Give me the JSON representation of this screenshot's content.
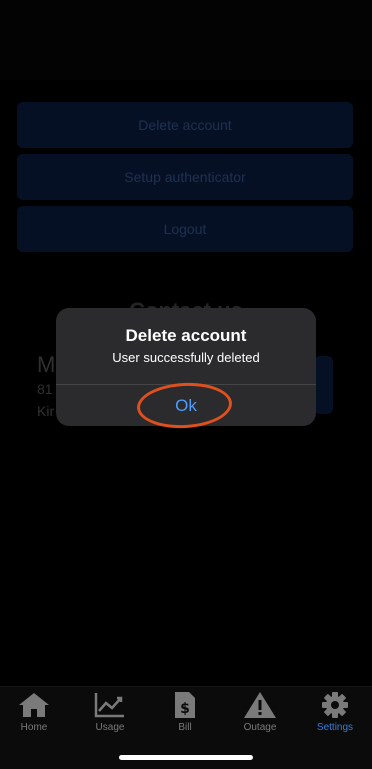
{
  "settings": {
    "delete_account": "Delete account",
    "setup_authenticator": "Setup authenticator",
    "logout": "Logout"
  },
  "contact": {
    "title": "Contact us",
    "name": "M",
    "line1": "81",
    "line2": "Kir"
  },
  "alert": {
    "title": "Delete account",
    "message": "User successfully deleted",
    "ok_label": "Ok"
  },
  "tabs": [
    {
      "label": "Home",
      "icon": "home-icon"
    },
    {
      "label": "Usage",
      "icon": "chart-icon"
    },
    {
      "label": "Bill",
      "icon": "bill-icon"
    },
    {
      "label": "Outage",
      "icon": "warning-icon"
    },
    {
      "label": "Settings",
      "icon": "gear-icon",
      "active": true
    }
  ],
  "colors": {
    "accent": "#3a7bd5",
    "alert_link": "#4f9cff",
    "annotation": "#e0501d"
  }
}
